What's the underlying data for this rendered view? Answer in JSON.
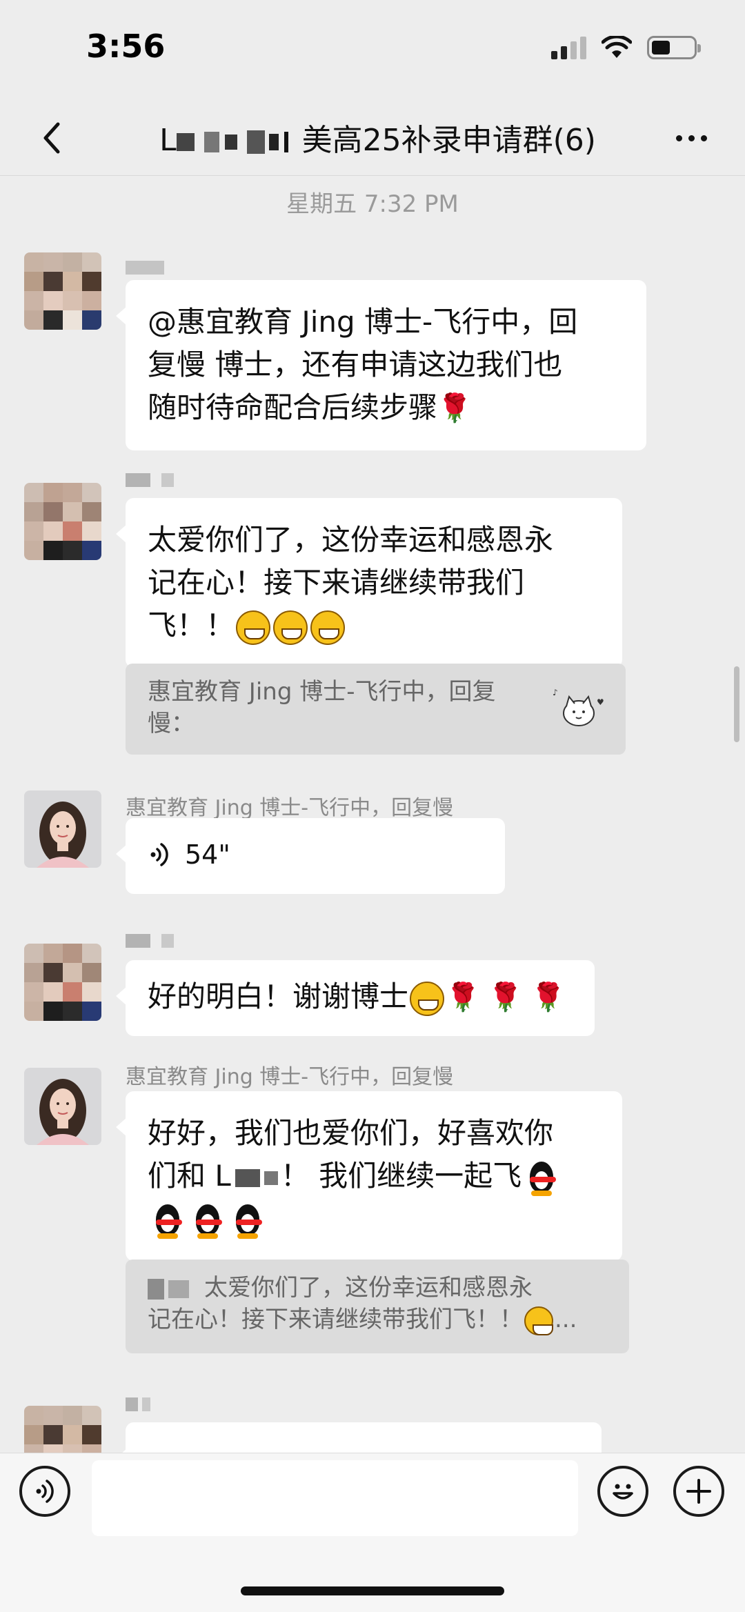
{
  "status_bar": {
    "time": "3:56"
  },
  "nav": {
    "title_suffix": "美高25补录申请群(6)"
  },
  "chat": {
    "timestamp": "星期五 7:32 PM",
    "messages": [
      {
        "text_line1": "@惠宜教育 Jing 博士-飞行中，回",
        "text_line2": "复慢 博士，还有申请这边我们也",
        "text_line3": "随时待命配合后续步骤"
      },
      {
        "text_line1": "太爱你们了，这份幸运和感恩永",
        "text_line2": "记在心！接下来请继续带我们",
        "text_line3": "飞！！",
        "quote_line1": "惠宜教育 Jing 博士-飞行中，回复",
        "quote_line2": "慢："
      },
      {
        "sender": "惠宜教育 Jing 博士-飞行中，回复慢",
        "voice_duration": "54\""
      },
      {
        "text": "好的明白！谢谢博士"
      },
      {
        "sender": "惠宜教育 Jing 博士-飞行中，回复慢",
        "text_line1": "好好，我们也爱你们，好喜欢你",
        "text_line2a": "们和 L",
        "text_line2b": "！ 我们继续一起飞",
        "quote_line1": "太爱你们了，这份幸运和感恩永",
        "quote_line2": "记在心！接下来请继续带我们飞！！",
        "quote_ellipsis": "..."
      }
    ]
  },
  "icons": {
    "rose": "🌹",
    "back": "chevron-left-icon",
    "more": "more-dots-icon"
  }
}
